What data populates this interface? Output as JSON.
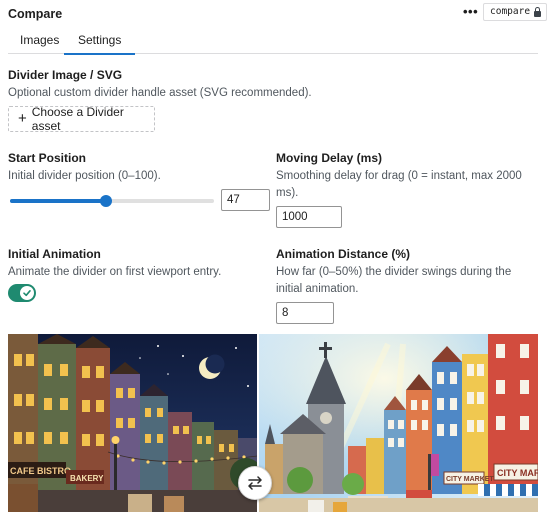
{
  "panel": {
    "title": "Compare",
    "more_icon": "more-vertical-icon",
    "block_tag": "compare",
    "lock_icon": "lock-icon"
  },
  "tabs": [
    {
      "label": "Images",
      "active": false
    },
    {
      "label": "Settings",
      "active": true
    }
  ],
  "divider_image": {
    "title": "Divider Image / SVG",
    "help": "Optional custom divider handle asset (SVG recommended).",
    "button_label": "Choose a Divider asset",
    "button_icon": "plus-icon"
  },
  "start_position": {
    "title": "Start Position",
    "help": "Initial divider position (0–100).",
    "value": "47",
    "min": 0,
    "max": 100
  },
  "moving_delay": {
    "title": "Moving Delay (ms)",
    "help": "Smoothing delay for drag (0 = instant, max 2000 ms).",
    "value": "1000"
  },
  "initial_animation": {
    "title": "Initial Animation",
    "help": "Animate the divider on first viewport entry.",
    "enabled": true
  },
  "animation_distance": {
    "title": "Animation Distance (%)",
    "help": "How far (0–50%) the divider swings during the initial animation.",
    "value": "8"
  },
  "preview": {
    "left_signs": [
      "CAFE BISTRO",
      "BAKERY"
    ],
    "right_signs": [
      "CITY MARKET",
      "CITY MARKE"
    ],
    "handle_icon": "swap-arrows-icon"
  },
  "colors": {
    "accent": "#1a73c8",
    "toggle_on": "#1f8a70"
  }
}
